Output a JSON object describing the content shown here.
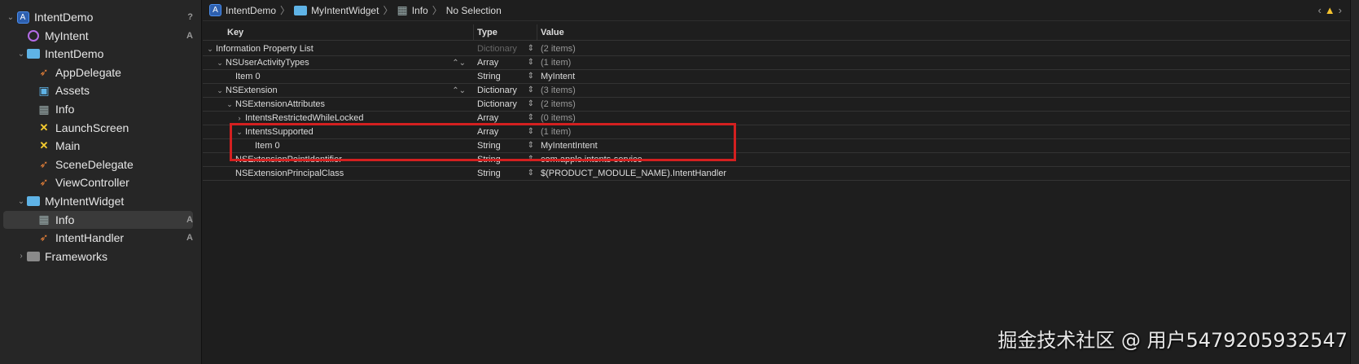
{
  "sidebar": {
    "items": [
      {
        "label": "IntentDemo",
        "icon": "project-icon",
        "badge": "?",
        "chev": "v",
        "indent": 0
      },
      {
        "label": "MyIntent",
        "icon": "intent-icon",
        "badge": "A",
        "chev": "",
        "indent": 1
      },
      {
        "label": "IntentDemo",
        "icon": "folder-icon",
        "badge": "",
        "chev": "v",
        "indent": 1
      },
      {
        "label": "AppDelegate",
        "icon": "swift-icon",
        "badge": "",
        "chev": "",
        "indent": 2
      },
      {
        "label": "Assets",
        "icon": "assets-icon",
        "badge": "",
        "chev": "",
        "indent": 2
      },
      {
        "label": "Info",
        "icon": "plist-icon",
        "badge": "",
        "chev": "",
        "indent": 2
      },
      {
        "label": "LaunchScreen",
        "icon": "storyboard-icon",
        "badge": "",
        "chev": "",
        "indent": 2
      },
      {
        "label": "Main",
        "icon": "storyboard-icon",
        "badge": "",
        "chev": "",
        "indent": 2
      },
      {
        "label": "SceneDelegate",
        "icon": "swift-icon",
        "badge": "",
        "chev": "",
        "indent": 2
      },
      {
        "label": "ViewController",
        "icon": "swift-icon",
        "badge": "",
        "chev": "",
        "indent": 2
      },
      {
        "label": "MyIntentWidget",
        "icon": "folder-icon",
        "badge": "",
        "chev": "v",
        "indent": 1
      },
      {
        "label": "Info",
        "icon": "plist-icon",
        "badge": "A",
        "chev": "",
        "indent": 2,
        "selected": true
      },
      {
        "label": "IntentHandler",
        "icon": "swift-icon",
        "badge": "A",
        "chev": "",
        "indent": 2
      },
      {
        "label": "Frameworks",
        "icon": "folder-gray-icon",
        "badge": "",
        "chev": ">",
        "indent": 1
      }
    ]
  },
  "breadcrumb": [
    "IntentDemo",
    "MyIntentWidget",
    "Info",
    "No Selection"
  ],
  "table": {
    "headers": [
      "Key",
      "Type",
      "Value"
    ],
    "rows": [
      {
        "key": "Information Property List",
        "type": "Dictionary",
        "value": "(2 items)",
        "indent": 0,
        "arrow": "v",
        "typeDim": true
      },
      {
        "key": "NSUserActivityTypes",
        "type": "Array",
        "value": "(1 item)",
        "indent": 1,
        "arrow": "v",
        "keyStepper": true
      },
      {
        "key": "Item 0",
        "type": "String",
        "value": "MyIntent",
        "indent": 2,
        "arrow": ""
      },
      {
        "key": "NSExtension",
        "type": "Dictionary",
        "value": "(3 items)",
        "indent": 1,
        "arrow": "v",
        "keyStepper": true
      },
      {
        "key": "NSExtensionAttributes",
        "type": "Dictionary",
        "value": "(2 items)",
        "indent": 2,
        "arrow": "v"
      },
      {
        "key": "IntentsRestrictedWhileLocked",
        "type": "Array",
        "value": "(0 items)",
        "indent": 3,
        "arrow": ">"
      },
      {
        "key": "IntentsSupported",
        "type": "Array",
        "value": "(1 item)",
        "indent": 3,
        "arrow": "v"
      },
      {
        "key": "Item 0",
        "type": "String",
        "value": "MyIntentIntent",
        "indent": 4,
        "arrow": ""
      },
      {
        "key": "NSExtensionPointIdentifier",
        "type": "String",
        "value": "com.apple.intents-service",
        "indent": 2,
        "arrow": ""
      },
      {
        "key": "NSExtensionPrincipalClass",
        "type": "String",
        "value": "$(PRODUCT_MODULE_NAME).IntentHandler",
        "indent": 2,
        "arrow": ""
      }
    ]
  },
  "watermark": "掘金技术社区 @ 用户5479205932547",
  "colors": {
    "highlight": "#d42020",
    "accent": "#4b8ff0"
  }
}
